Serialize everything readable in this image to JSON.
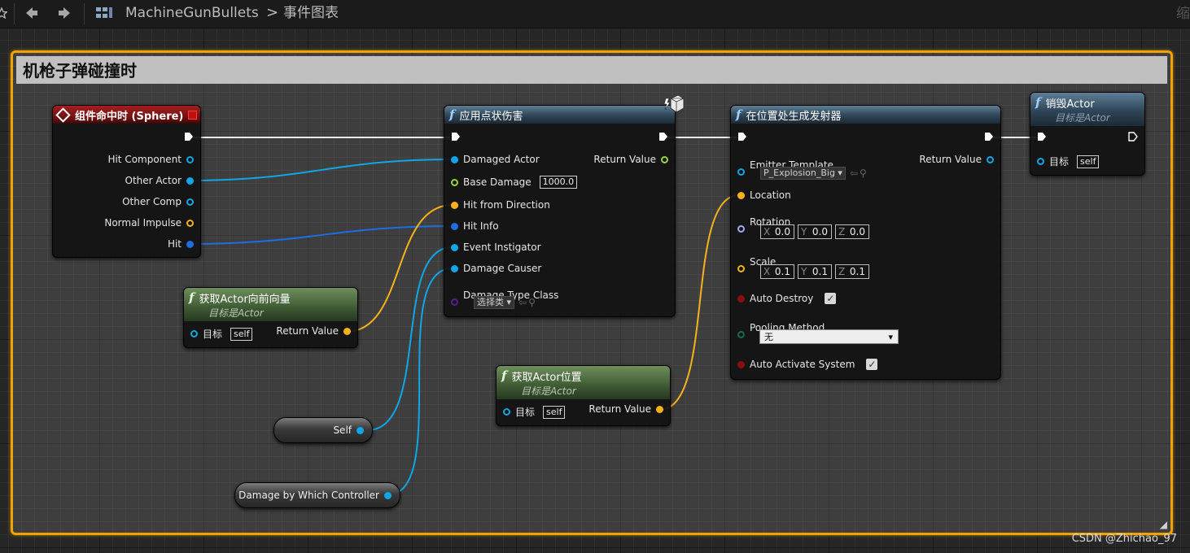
{
  "breadcrumb": {
    "blueprint_name": "MachineGunBullets",
    "separator": ">",
    "graph_name": "事件图表"
  },
  "zoom_label": "缩",
  "comment": {
    "title": "机枪子弹碰撞时"
  },
  "colors": {
    "object_pin": "#11a6e6",
    "struct_pin": "#f7b21b",
    "hitresult_pin": "#1d6ee0",
    "float_pin": "#9bd33a",
    "class_pin": "#5a1e8c",
    "rotator_pin": "#a0a8ff",
    "bool_pin": "#8c0f0f",
    "enum_pin": "#0f6b55",
    "comment_border": "#f2a200"
  },
  "nodes": {
    "event_hit": {
      "title": "组件命中时 (Sphere)",
      "pins": [
        "Hit Component",
        "Other Actor",
        "Other Comp",
        "Normal Impulse",
        "Hit"
      ]
    },
    "apply_damage": {
      "title": "应用点状伤害",
      "inputs": [
        "Damaged Actor",
        "Base Damage",
        "Hit from Direction",
        "Hit Info",
        "Event Instigator",
        "Damage Causer",
        "Damage Type Class"
      ],
      "base_damage_value": "1000.0",
      "damage_type_value": "选择类",
      "return_label": "Return Value"
    },
    "spawn_emitter": {
      "title": "在位置处生成发射器",
      "emitter_label": "Emitter Template",
      "emitter_value": "P_Explosion_Big",
      "return_label": "Return Value",
      "location_label": "Location",
      "rotation_label": "Rotation",
      "rotation": {
        "x": "0.0",
        "y": "0.0",
        "z": "0.0"
      },
      "scale_label": "Scale",
      "scale": {
        "x": "0.1",
        "y": "0.1",
        "z": "0.1"
      },
      "auto_destroy_label": "Auto Destroy",
      "pooling_label": "Pooling Method",
      "pooling_value": "无",
      "auto_activate_label": "Auto Activate System",
      "axis_x": "X",
      "axis_y": "Y",
      "axis_z": "Z"
    },
    "destroy_actor": {
      "title": "销毁Actor",
      "subtitle": "目标是Actor",
      "target_label": "目标",
      "target_value": "self"
    },
    "get_forward": {
      "title": "获取Actor向前向量",
      "subtitle": "目标是Actor",
      "target_label": "目标",
      "target_value": "self",
      "return_label": "Return Value"
    },
    "get_location": {
      "title": "获取Actor位置",
      "subtitle": "目标是Actor",
      "target_label": "目标",
      "target_value": "self",
      "return_label": "Return Value"
    },
    "self_ref": {
      "label": "Self"
    },
    "damage_controller": {
      "label": "Damage by Which Controller"
    }
  },
  "watermark": "CSDN @Zhichao_97"
}
